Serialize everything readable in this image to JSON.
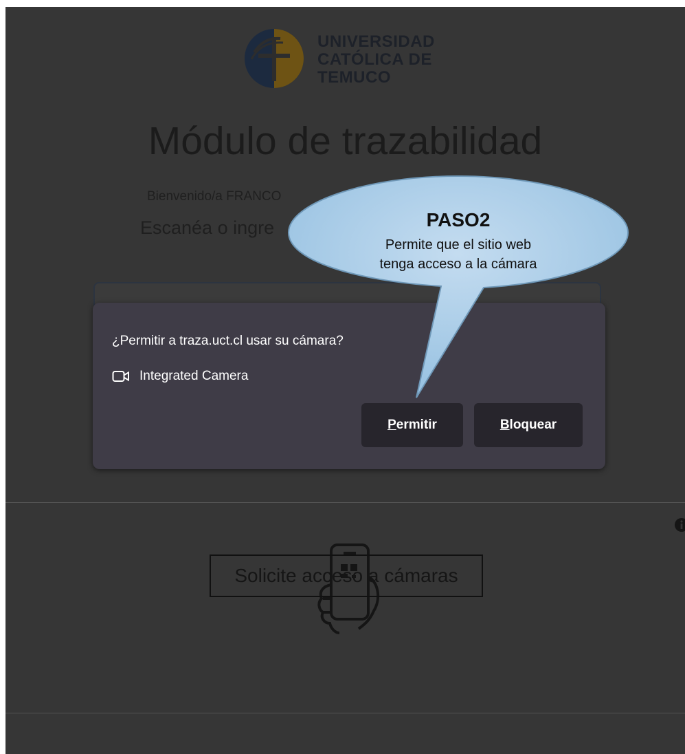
{
  "logo": {
    "lines": [
      "UNIVERSIDAD",
      "CATÓLICA DE",
      "TEMUCO"
    ]
  },
  "page_title": "Módulo de trazabilidad",
  "welcome_text": "Bienvenido/a FRANCO",
  "scan_text": "Escanéa o ingre",
  "callout": {
    "title": "PASO2",
    "line1": "Permite que el sitio web",
    "line2": "tenga acceso a la cámara"
  },
  "permission_dialog": {
    "question": "¿Permitir a traza.uct.cl usar su cámara?",
    "device": "Integrated Camera",
    "allow_label": "Permitir",
    "block_label": "Bloquear"
  },
  "camera_access_button": "Solicite acceso a cámaras",
  "icons": {
    "info": "info-icon",
    "phone": "phone-scan-icon",
    "camera": "video-camera-icon"
  },
  "colors": {
    "overlay_bg": "#363636",
    "dialog_bg": "#3f3c47",
    "button_bg": "#27252c",
    "callout_fill": "#a6cbe6"
  }
}
